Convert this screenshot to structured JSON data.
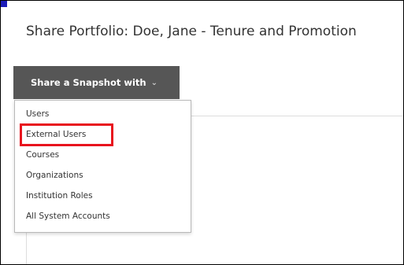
{
  "page": {
    "title": "Share Portfolio: Doe, Jane - Tenure and Promotion"
  },
  "share_button": {
    "label": "Share a Snapshot with",
    "icon": "chevron-down-icon"
  },
  "menu": {
    "items": [
      {
        "label": "Users"
      },
      {
        "label": "External Users",
        "highlighted": true
      },
      {
        "label": "Courses"
      },
      {
        "label": "Organizations"
      },
      {
        "label": "Institution Roles"
      },
      {
        "label": "All System Accounts"
      }
    ]
  },
  "colors": {
    "button_bg": "#565656",
    "highlight_border": "#e8131d",
    "corner_marker": "#1b1bb8"
  }
}
